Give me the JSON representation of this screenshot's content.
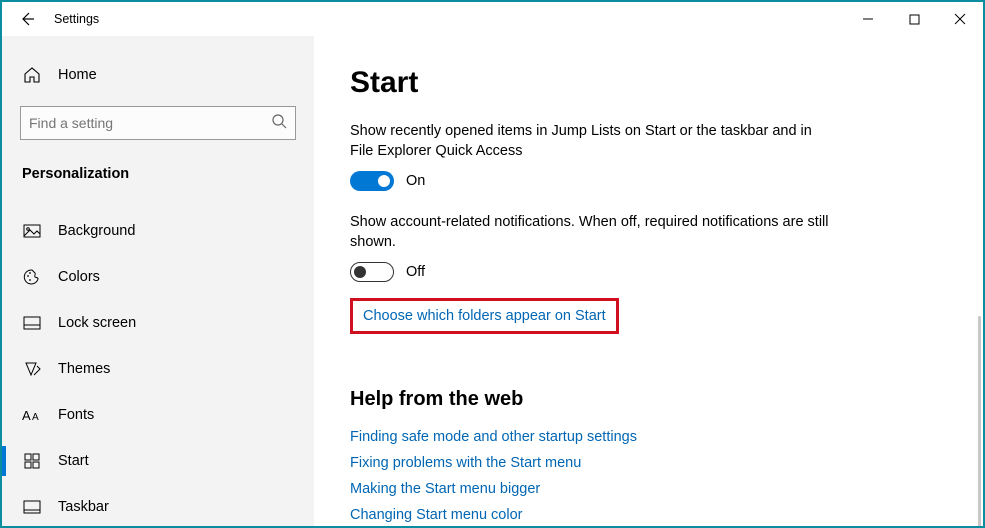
{
  "titlebar": {
    "title": "Settings"
  },
  "sidebar": {
    "home_label": "Home",
    "search_placeholder": "Find a setting",
    "section_title": "Personalization",
    "items": [
      {
        "label": "Background"
      },
      {
        "label": "Colors"
      },
      {
        "label": "Lock screen"
      },
      {
        "label": "Themes"
      },
      {
        "label": "Fonts"
      },
      {
        "label": "Start"
      },
      {
        "label": "Taskbar"
      }
    ]
  },
  "main": {
    "title": "Start",
    "settings": [
      {
        "desc": "Show recently opened items in Jump Lists on Start or the taskbar and in File Explorer Quick Access",
        "state_label": "On"
      },
      {
        "desc": "Show account-related notifications. When off, required notifications are still shown.",
        "state_label": "Off"
      }
    ],
    "choose_folders_link": "Choose which folders appear on Start",
    "help_heading": "Help from the web",
    "help_links": [
      "Finding safe mode and other startup settings",
      "Fixing problems with the Start menu",
      "Making the Start menu bigger",
      "Changing Start menu color"
    ]
  }
}
